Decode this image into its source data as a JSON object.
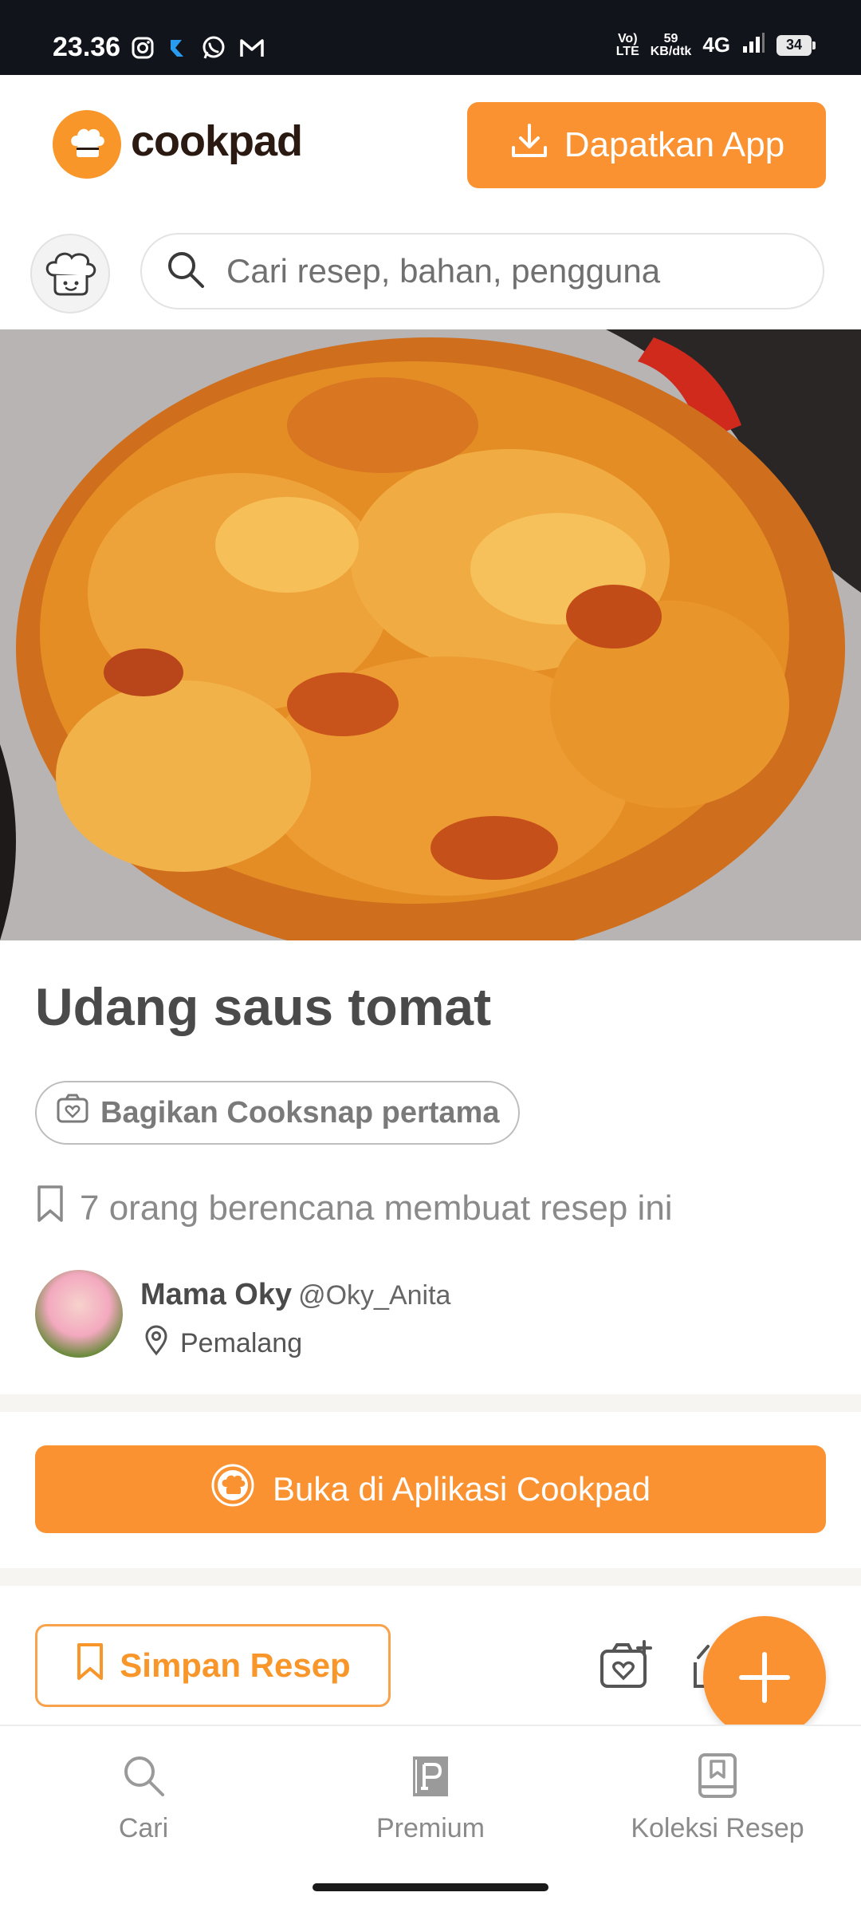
{
  "status_bar": {
    "time": "23.36",
    "volte_line1": "Vo)",
    "volte_line2": "LTE",
    "speed_value": "59",
    "speed_unit": "KB/dtk",
    "network": "4G",
    "battery": "34",
    "notification_icons": [
      "instagram-icon",
      "app-r-icon",
      "whatsapp-icon",
      "gmail-icon"
    ]
  },
  "header": {
    "logo_text": "cookpad",
    "get_app_label": "Dapatkan App"
  },
  "search": {
    "placeholder": "Cari resep, bahan, pengguna"
  },
  "recipe": {
    "title": "Udang saus tomat",
    "cooksnap_label": "Bagikan Cooksnap pertama",
    "plan_text": "7 orang berencana membuat resep ini",
    "author": {
      "name": "Mama Oky",
      "handle": "@Oky_Anita",
      "location": "Pemalang"
    },
    "open_app_label": "Buka di Aplikasi Cookpad",
    "save_label": "Simpan Resep"
  },
  "bottom_nav": {
    "items": [
      {
        "label": "Cari",
        "icon": "search-icon"
      },
      {
        "label": "Premium",
        "icon": "premium-icon"
      },
      {
        "label": "Koleksi Resep",
        "icon": "collection-icon"
      }
    ]
  },
  "colors": {
    "brand_orange": "#fa9232",
    "status_bar_bg": "#12141c",
    "text_dark": "#4a4a4a"
  }
}
